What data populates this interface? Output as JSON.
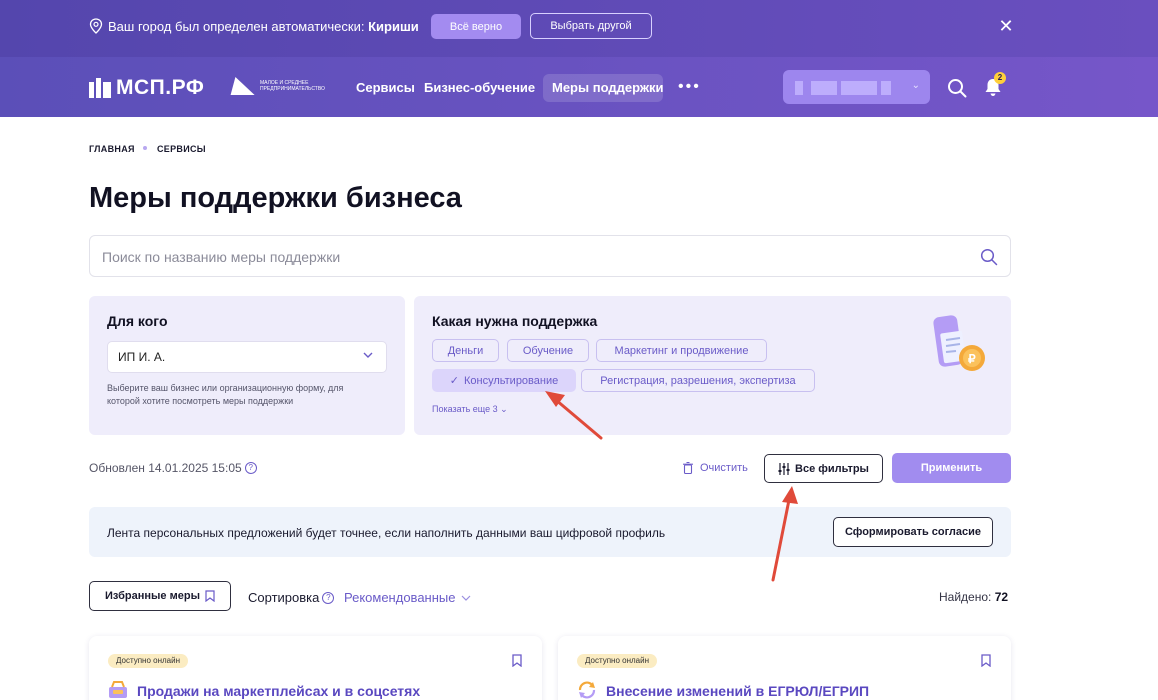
{
  "city_banner": {
    "message": "Ваш город был определен автоматически: ",
    "city": "Кириши",
    "confirm_label": "Всё верно",
    "choose_other_label": "Выбрать другой",
    "close_symbol": "✕"
  },
  "header": {
    "logo_text": "МСП.РФ",
    "partner_logo_text": "малое и среднее предпринимательство",
    "nav": [
      "Сервисы",
      "Бизнес-обучение",
      "Меры поддержки"
    ],
    "more_symbol": "•••",
    "notifications_count": "2"
  },
  "breadcrumb": [
    "ГЛАВНАЯ",
    "СЕРВИСЫ"
  ],
  "page_title": "Меры поддержки бизнеса",
  "search": {
    "placeholder": "Поиск по названию меры поддержки"
  },
  "for_whom": {
    "title": "Для кого",
    "selected_value": "ИП И. А.",
    "hint": "Выберите ваш бизнес или организационную форму, для которой хотите посмотреть меры поддержки"
  },
  "support_type": {
    "title": "Какая нужна поддержка",
    "chips": [
      "Деньги",
      "Обучение",
      "Маркетинг и продвижение",
      "Консультирование",
      "Регистрация, разрешения, экспертиза"
    ],
    "selected_chip": "Консультирование",
    "show_more": "Показать еще 3"
  },
  "status": {
    "updated": "Обновлен 14.01.2025 15:05",
    "clear_label": "Очистить",
    "all_filters_label": "Все фильтры",
    "apply_label": "Применить"
  },
  "info_banner": {
    "text": "Лента персональных предложений будет точнее, если наполнить данными ваш цифровой профиль",
    "button_label": "Сформировать согласие"
  },
  "sorting": {
    "favorites_label": "Избранные меры",
    "sort_label": "Сортировка",
    "sort_value": "Рекомендованные",
    "found_label": "Найдено: ",
    "found_count": "72"
  },
  "cards": [
    {
      "badge": "Доступно онлайн",
      "title": "Продажи на маркетплейсах и в соцсетях"
    },
    {
      "badge": "Доступно онлайн",
      "title": "Внесение изменений в ЕГРЮЛ/ЕГРИП"
    }
  ],
  "colors": {
    "brand_purple": "#6a4fbf",
    "accent_violet": "#a18cef",
    "link": "#6a5bc8",
    "annotation_arrow": "#e04a3a"
  }
}
